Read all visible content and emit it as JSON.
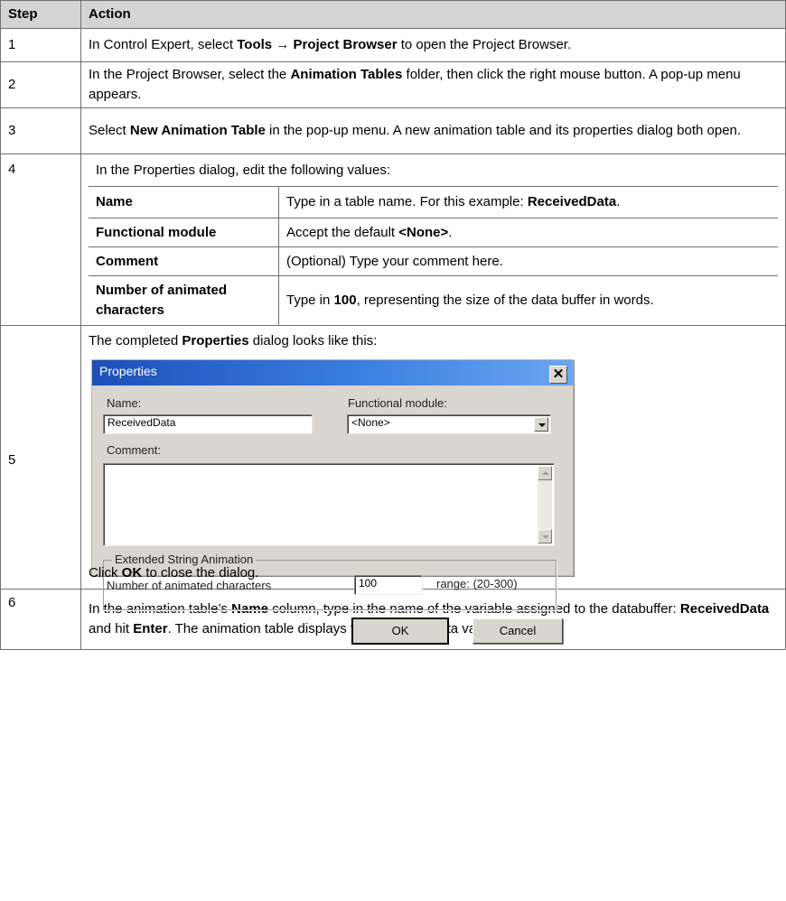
{
  "header": {
    "step": "Step",
    "action": "Action"
  },
  "rows": [
    {
      "step": "1",
      "parts": [
        "In Control Expert, select ",
        "Tools",
        " → ",
        "Project Browser",
        " to open the Project Browser."
      ]
    },
    {
      "step": "2",
      "parts": [
        "In the Project Browser, select the ",
        "Animation Tables",
        " folder, then click the right mouse button. A pop-up menu appears."
      ]
    },
    {
      "step": "3",
      "parts": [
        "Select ",
        "New Animation Table",
        " in the pop-up menu. A new animation table and its properties dialog both open."
      ]
    },
    {
      "step": "4",
      "text": "In the Properties dialog, edit the following values:"
    },
    {
      "step": "5",
      "parts": [
        "The completed ",
        "Properties",
        " dialog looks like this:"
      ],
      "after": [
        "Click ",
        "OK",
        " to close the dialog."
      ]
    },
    {
      "step": "6",
      "parts": [
        "In the animation table’s ",
        "Name",
        " column, type in the name of the variable assigned to the databuffer: ",
        "ReceivedData",
        " and hit ",
        "Enter",
        ". The animation table displays the ReceivedData variable."
      ]
    }
  ],
  "fields": [
    {
      "name": "Name",
      "parts": [
        "Type in a table name. For this example: ",
        "ReceivedData",
        "."
      ]
    },
    {
      "name": "Functional module",
      "parts": [
        "Accept the default ",
        "<None>",
        "."
      ]
    },
    {
      "name": "Comment",
      "parts": [
        "(Optional) Type your comment here."
      ]
    },
    {
      "name": "Number of animated characters",
      "parts": [
        "Type in ",
        "100",
        ", representing the size of the data buffer in words."
      ]
    }
  ],
  "dialog": {
    "title": "Properties",
    "close_glyph": "✕",
    "name_label": "Name:",
    "name_value": "ReceivedData",
    "functional_module_label": "Functional module:",
    "functional_module_value": "<None>",
    "comment_label": "Comment:",
    "comment_value": "",
    "group_label": "Extended String Animation",
    "chars_label": "Number of animated characters",
    "chars_value": "100",
    "range_text": "range: (20-300)",
    "ok_label": "OK",
    "cancel_label": "Cancel"
  }
}
